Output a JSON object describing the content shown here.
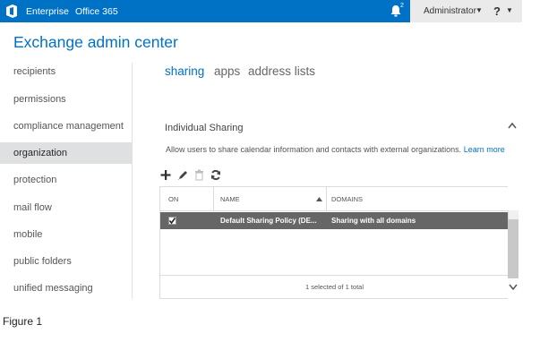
{
  "topbar": {
    "brand_links": [
      "Enterprise",
      "Office 365"
    ],
    "notification_count": "2",
    "user_label": "Administrator",
    "help_label": "?"
  },
  "app": {
    "title": "Exchange admin center"
  },
  "nav": {
    "items": [
      {
        "label": "recipients",
        "active": false
      },
      {
        "label": "permissions",
        "active": false
      },
      {
        "label": "compliance management",
        "active": false
      },
      {
        "label": "organization",
        "active": true
      },
      {
        "label": "protection",
        "active": false
      },
      {
        "label": "mail flow",
        "active": false
      },
      {
        "label": "mobile",
        "active": false
      },
      {
        "label": "public folders",
        "active": false
      },
      {
        "label": "unified messaging",
        "active": false
      }
    ]
  },
  "tabs": [
    {
      "label": "sharing",
      "active": true
    },
    {
      "label": "apps",
      "active": false
    },
    {
      "label": "address lists",
      "active": false
    }
  ],
  "section": {
    "title": "Individual Sharing",
    "description": "Allow users to share calendar information and contacts with external organizations.",
    "learn_more": "Learn more"
  },
  "toolbar": {
    "icons": [
      "add-icon",
      "edit-icon",
      "delete-icon",
      "refresh-icon"
    ]
  },
  "grid": {
    "columns": [
      "ON",
      "NAME",
      "DOMAINS"
    ],
    "rows": [
      {
        "on": true,
        "name": "Default Sharing Policy (DE...",
        "domains": "Sharing with all domains",
        "selected": true
      }
    ],
    "status": "1 selected of 1 total"
  },
  "caption": "Figure 1",
  "colors": {
    "accent": "#0072c6",
    "selected_row": "#666666",
    "active_nav": "#dfe0e2"
  }
}
